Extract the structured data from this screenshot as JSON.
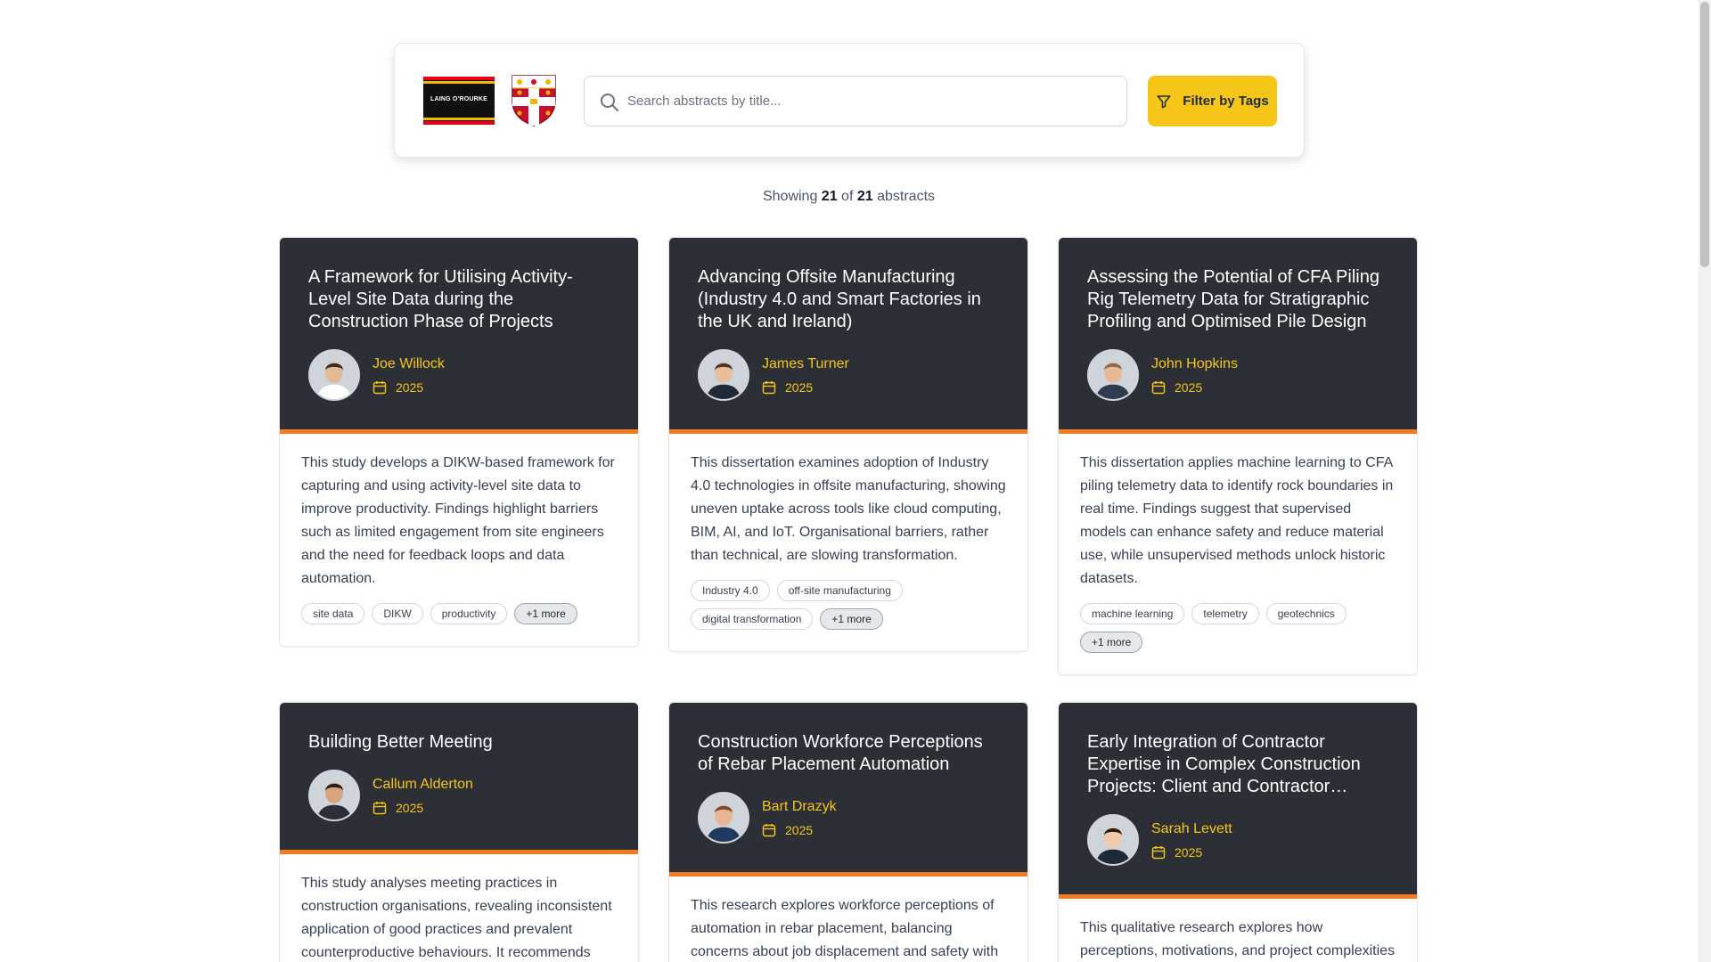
{
  "header": {
    "logo_lor_text": "LAING O'ROURKE",
    "search_placeholder": "Search abstracts by title...",
    "filter_label": "Filter by Tags",
    "colors": {
      "accent": "#f5c518",
      "card_header": "#2d2f36",
      "card_stripe": "#f47a20"
    }
  },
  "results": {
    "prefix": "Showing",
    "shown": "21",
    "middle": "of",
    "total": "21",
    "suffix": "abstracts"
  },
  "cards": [
    {
      "title": "A Framework for Utilising Activity-Level Site Data during the Construction Phase of Projects",
      "author": "Joe Willock",
      "year": "2025",
      "abstract": "This study develops a DIKW-based framework for capturing and using activity-level site data to improve productivity. Findings highlight barriers such as limited engagement from site engineers and the need for feedback loops and data automation.",
      "tags": [
        "site data",
        "DIKW",
        "productivity"
      ],
      "more": "+1 more"
    },
    {
      "title": "Advancing Offsite Manufacturing (Industry 4.0 and Smart Factories in the UK and Ireland)",
      "author": "James Turner",
      "year": "2025",
      "abstract": "This dissertation examines adoption of Industry 4.0 technologies in offsite manufacturing, showing uneven uptake across tools like cloud computing, BIM, AI, and IoT. Organisational barriers, rather than technical, are slowing transformation.",
      "tags": [
        "Industry 4.0",
        "off-site manufacturing",
        "digital transformation"
      ],
      "more": "+1 more"
    },
    {
      "title": "Assessing the Potential of CFA Piling Rig Telemetry Data for Stratigraphic Profiling and Optimised Pile Design",
      "author": "John Hopkins",
      "year": "2025",
      "abstract": "This dissertation applies machine learning to CFA piling telemetry data to identify rock boundaries in real time. Findings suggest that supervised models can enhance safety and reduce material use, while unsupervised methods unlock historic datasets.",
      "tags": [
        "machine learning",
        "telemetry",
        "geotechnics"
      ],
      "more": "+1 more"
    },
    {
      "title": "Building Better Meeting",
      "author": "Callum Alderton",
      "year": "2025",
      "abstract": "This study analyses meeting practices in construction organisations, revealing inconsistent application of good practices and prevalent counterproductive behaviours. It recommends",
      "tags": [],
      "more": ""
    },
    {
      "title": "Construction Workforce Perceptions of Rebar Placement Automation",
      "author": "Bart Drazyk",
      "year": "2025",
      "abstract": "This research explores workforce perceptions of automation in rebar placement, balancing concerns about job displacement and safety with",
      "tags": [],
      "more": ""
    },
    {
      "title": "Early Integration of Contractor Expertise in Complex Construction Projects: Client and Contractor Perspectives",
      "author": "Sarah Levett",
      "year": "2025",
      "abstract": "This qualitative research explores how perceptions, motivations, and project complexities",
      "tags": [],
      "more": ""
    }
  ]
}
